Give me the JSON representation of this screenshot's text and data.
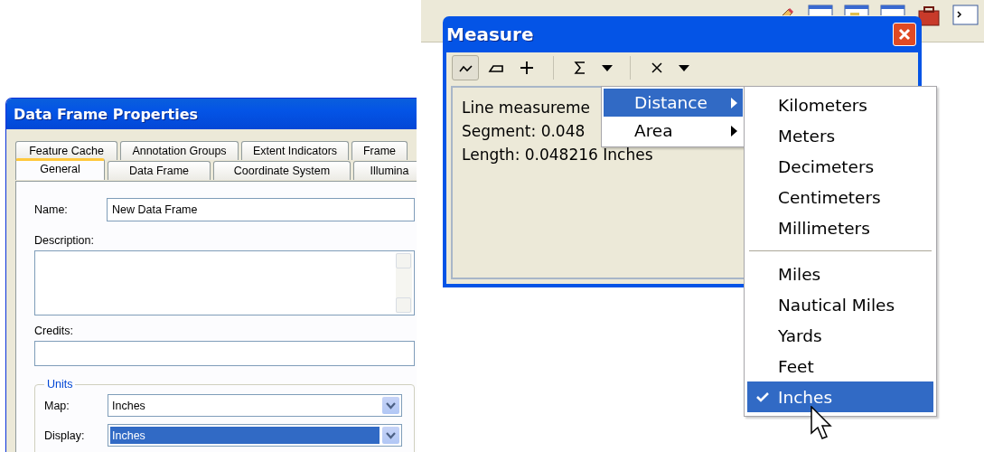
{
  "data_frame_dialog": {
    "title": "Data Frame Properties",
    "tab_rows": [
      [
        {
          "label": "Feature Cache",
          "selected": false
        },
        {
          "label": "Annotation Groups",
          "selected": false
        },
        {
          "label": "Extent Indicators",
          "selected": false
        },
        {
          "label": "Frame",
          "selected": false
        }
      ],
      [
        {
          "label": "General",
          "selected": true
        },
        {
          "label": "Data Frame",
          "selected": false
        },
        {
          "label": "Coordinate System",
          "selected": false
        },
        {
          "label": "Illumina",
          "selected": false
        }
      ]
    ],
    "name": {
      "label": "Name:",
      "value": "New Data Frame"
    },
    "description": {
      "label": "Description:"
    },
    "credits": {
      "label": "Credits:"
    },
    "units": {
      "legend": "Units",
      "rows": [
        {
          "label": "Map:",
          "value": "Inches",
          "selected": false
        },
        {
          "label": "Display:",
          "value": "Inches",
          "selected": true
        }
      ]
    }
  },
  "measure_window": {
    "title": "Measure",
    "tools": [
      {
        "kind": "tool",
        "selected": true
      },
      {
        "kind": "tool",
        "selected": false
      },
      {
        "kind": "tool",
        "selected": false
      },
      {
        "kind": "separator"
      },
      {
        "kind": "button"
      },
      {
        "kind": "dropdown"
      },
      {
        "kind": "separator"
      },
      {
        "kind": "button"
      },
      {
        "kind": "dropdown"
      }
    ],
    "results": [
      "Line measureme",
      "Segment: 0.048",
      "Length: 0.048216 Inches"
    ]
  },
  "unit_type_menu": {
    "items": [
      {
        "label": "Distance",
        "selected": true,
        "has_submenu": true
      },
      {
        "label": "Area",
        "selected": false,
        "has_submenu": true
      }
    ]
  },
  "distance_units_menu": {
    "items": [
      {
        "kind": "item",
        "label": "Kilometers",
        "checked": false,
        "selected": false
      },
      {
        "kind": "item",
        "label": "Meters",
        "checked": false,
        "selected": false
      },
      {
        "kind": "item",
        "label": "Decimeters",
        "checked": false,
        "selected": false
      },
      {
        "kind": "item",
        "label": "Centimeters",
        "checked": false,
        "selected": false
      },
      {
        "kind": "item",
        "label": "Millimeters",
        "checked": false,
        "selected": false
      },
      {
        "kind": "separator"
      },
      {
        "kind": "item",
        "label": "Miles",
        "checked": false,
        "selected": false
      },
      {
        "kind": "item",
        "label": "Nautical Miles",
        "checked": false,
        "selected": false
      },
      {
        "kind": "item",
        "label": "Yards",
        "checked": false,
        "selected": false
      },
      {
        "kind": "item",
        "label": "Feet",
        "checked": false,
        "selected": false
      },
      {
        "kind": "item",
        "label": "Inches",
        "checked": true,
        "selected": true
      }
    ]
  }
}
